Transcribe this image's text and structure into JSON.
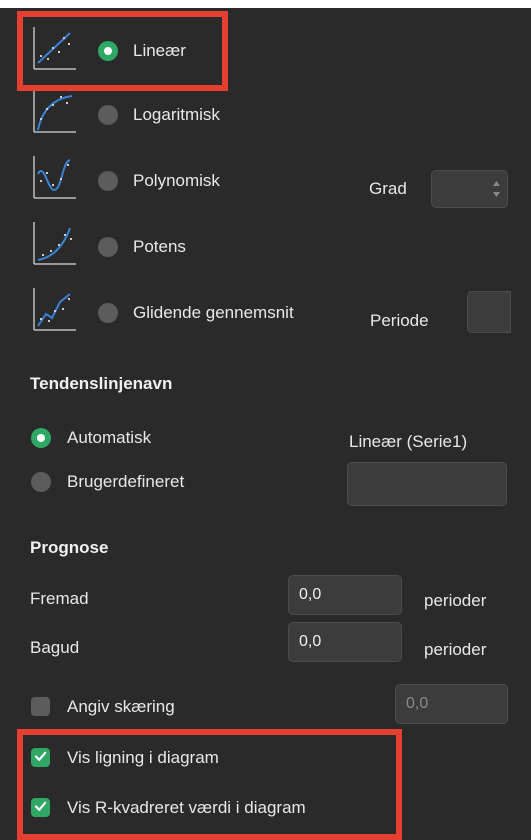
{
  "trendline_types": [
    {
      "label": "Lineær",
      "selected": true,
      "icon": "linear-trend-icon"
    },
    {
      "label": "Logaritmisk",
      "selected": false,
      "icon": "logarithmic-trend-icon"
    },
    {
      "label": "Polynomisk",
      "selected": false,
      "icon": "polynomial-trend-icon"
    },
    {
      "label": "Potens",
      "selected": false,
      "icon": "power-trend-icon"
    },
    {
      "label": "Glidende gennemsnit",
      "selected": false,
      "icon": "moving-average-trend-icon"
    }
  ],
  "polynomial": {
    "degree_label": "Grad",
    "degree_value": ""
  },
  "moving_average": {
    "period_label": "Periode",
    "period_value": ""
  },
  "trendline_name": {
    "heading": "Tendenslinjenavn",
    "automatic_label": "Automatisk",
    "automatic_selected": true,
    "automatic_value": "Lineær (Serie1)",
    "custom_label": "Brugerdefineret",
    "custom_value": ""
  },
  "forecast": {
    "heading": "Prognose",
    "forward_label": "Fremad",
    "forward_value": "0,0",
    "forward_unit": "perioder",
    "backward_label": "Bagud",
    "backward_value": "0,0",
    "backward_unit": "perioder"
  },
  "intercept": {
    "label": "Angiv skæring",
    "checked": false,
    "value": "0,0"
  },
  "show_equation": {
    "label": "Vis ligning i diagram",
    "checked": true
  },
  "show_r_squared": {
    "label": "Vis R-kvadreret værdi i diagram",
    "checked": true
  },
  "colors": {
    "accent": "#2fa866",
    "highlight": "#e5402f",
    "panel": "#2a2a2a",
    "trend_line": "#3b82d6"
  }
}
